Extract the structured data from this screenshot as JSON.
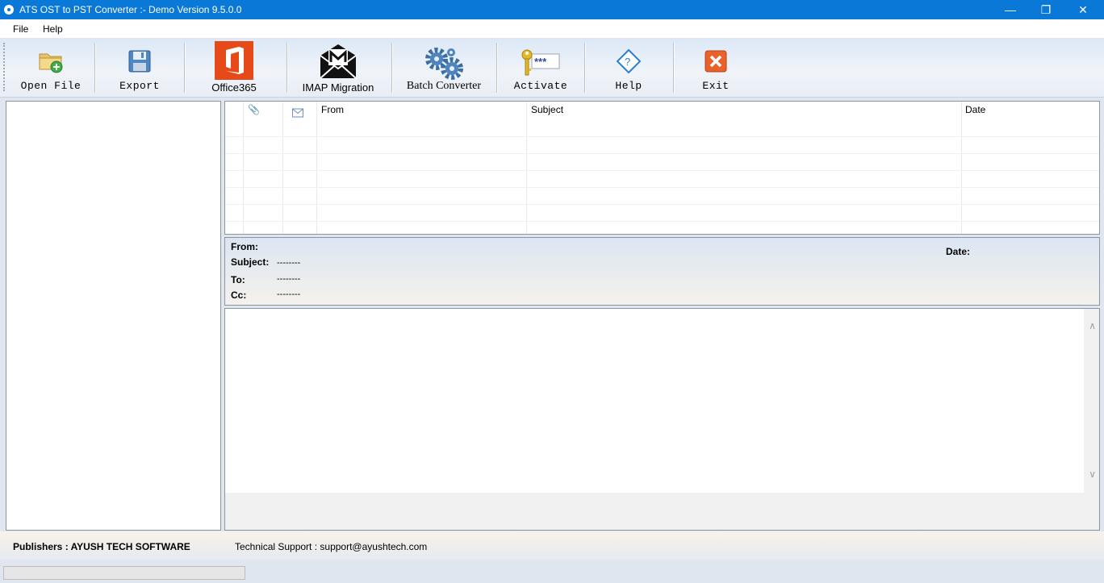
{
  "window": {
    "title": "ATS OST to PST Converter :- Demo Version 9.5.0.0"
  },
  "menu": {
    "file": "File",
    "help": "Help"
  },
  "toolbar": {
    "open_file": "Open File",
    "export": "Export",
    "office365": "Office365",
    "imap": "IMAP Migration",
    "batch": "Batch Converter",
    "activate": "Activate",
    "help": "Help",
    "exit": "Exit"
  },
  "mail_list": {
    "columns": {
      "from": "From",
      "subject": "Subject",
      "date": "Date"
    }
  },
  "header": {
    "from_label": "From:",
    "subject_label": "Subject:",
    "to_label": "To:",
    "cc_label": "Cc:",
    "date_label": "Date:",
    "subject_value": "--------",
    "to_value": "--------",
    "cc_value": "--------"
  },
  "status": {
    "publisher": "Publishers : AYUSH TECH SOFTWARE",
    "support": "Technical Support : support@ayushtech.com"
  },
  "colors": {
    "titlebar": "#0a78d7",
    "office_red": "#e64a19",
    "exit_orange": "#e8622c",
    "help_blue": "#2a7fd4"
  }
}
